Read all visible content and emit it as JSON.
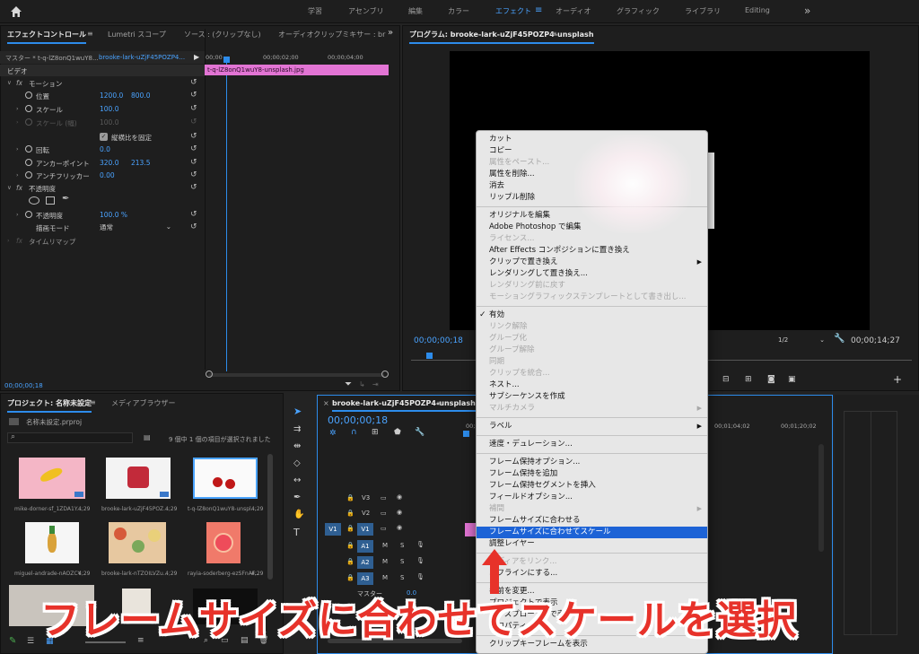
{
  "workspaces": [
    "学習",
    "アセンブリ",
    "編集",
    "カラー",
    "エフェクト",
    "オーディオ",
    "グラフィック",
    "ライブラリ",
    "Editing"
  ],
  "active_workspace": "エフェクト",
  "effect_controls": {
    "tabs": [
      "エフェクトコントロール",
      "Lumetri スコープ",
      "ソース : (クリップなし)",
      "オーディオクリップミキサー : br"
    ],
    "master_label": "マスター * t-q-lZ8onQ1wuY8...",
    "clip_label": "brooke-lark-uZjF45POZP4...",
    "section_video": "ビデオ",
    "motion": "モーション",
    "position": {
      "label": "位置",
      "x": "1200.0",
      "y": "800.0"
    },
    "scale": {
      "label": "スケール",
      "value": "100.0"
    },
    "scale_width": {
      "label": "スケール (幅)",
      "value": "100.0"
    },
    "uniform_scale": "縦横比を固定",
    "rotation": {
      "label": "回転",
      "value": "0.0"
    },
    "anchor": {
      "label": "アンカーポイント",
      "x": "320.0",
      "y": "213.5"
    },
    "antiflicker": {
      "label": "アンチフリッカー",
      "value": "0.00"
    },
    "opacity_section": "不透明度",
    "opacity": {
      "label": "不透明度",
      "value": "100.0 %"
    },
    "blend": {
      "label": "描画モード",
      "value": "通常"
    },
    "time_remap": "タイムリマップ",
    "ruler": [
      "00;00",
      "00;00;02;00",
      "00;00;04;00"
    ],
    "clip_name": "t-q-lZ8onQ1wuY8-unsplash.jpg",
    "timecode": "00;00;00;18"
  },
  "program": {
    "title": "プログラム: brooke-lark-uZjF45POZP4-unsplash",
    "timecode": "00;00;00;18",
    "resolution": "1/2",
    "duration": "00;00;14;27"
  },
  "project": {
    "tabs": [
      "プロジェクト: 名称未設定",
      "メディアブラウザー"
    ],
    "file": "名称未設定.prproj",
    "selection_info": "9 個中 1 個の項目が選択されました",
    "items": [
      {
        "name": "mike-dorner-sf_1ZDA1Y...",
        "dur": "4;29"
      },
      {
        "name": "brooke-lark-uZjF45POZ...",
        "dur": "4;29"
      },
      {
        "name": "t-q-lZ8onQ1wuY8-unspl...",
        "dur": "4;29"
      },
      {
        "name": "miguel-andrade-nAOZCY...",
        "dur": "4;29"
      },
      {
        "name": "brooke-lark-nTZOILVZu...",
        "dur": "4;29"
      },
      {
        "name": "rayia-soderberg-ezSFnAF...",
        "dur": "4;29"
      }
    ]
  },
  "timeline": {
    "sequence": "brooke-lark-uZjF45POZP4-unsplash",
    "timecode": "00;00;00;18",
    "ruler": [
      "00;00",
      "00;01;04;02",
      "00;01;20;02"
    ],
    "tracks": [
      "V3",
      "V2",
      "V1",
      "A1",
      "A2",
      "A3"
    ],
    "master": "マスター",
    "master_value": "0.0"
  },
  "context_menu": [
    {
      "label": "カット",
      "enabled": true
    },
    {
      "label": "コピー",
      "enabled": true
    },
    {
      "label": "属性をペースト...",
      "enabled": false
    },
    {
      "label": "属性を削除...",
      "enabled": true
    },
    {
      "label": "消去",
      "enabled": true
    },
    {
      "label": "リップル削除",
      "enabled": true
    },
    {
      "sep": true
    },
    {
      "label": "オリジナルを編集",
      "enabled": true
    },
    {
      "label": "Adobe Photoshop で編集",
      "enabled": true
    },
    {
      "label": "ライセンス...",
      "enabled": false
    },
    {
      "label": "After Effects コンポジションに置き換え",
      "enabled": true
    },
    {
      "label": "クリップで置き換え",
      "enabled": true,
      "submenu": true
    },
    {
      "label": "レンダリングして置き換え...",
      "enabled": true
    },
    {
      "label": "レンダリング前に戻す",
      "enabled": false
    },
    {
      "label": "モーショングラフィックステンプレートとして書き出し...",
      "enabled": false
    },
    {
      "sep": true
    },
    {
      "label": "有効",
      "enabled": true,
      "checked": true
    },
    {
      "label": "リンク解除",
      "enabled": false
    },
    {
      "label": "グループ化",
      "enabled": false
    },
    {
      "label": "グループ解除",
      "enabled": false
    },
    {
      "label": "同期",
      "enabled": false
    },
    {
      "label": "クリップを統合...",
      "enabled": false
    },
    {
      "label": "ネスト...",
      "enabled": true
    },
    {
      "label": "サブシーケンスを作成",
      "enabled": true
    },
    {
      "label": "マルチカメラ",
      "enabled": false,
      "submenu": true
    },
    {
      "sep": true
    },
    {
      "label": "ラベル",
      "enabled": true,
      "submenu": true
    },
    {
      "sep": true
    },
    {
      "label": "速度・デュレーション...",
      "enabled": true
    },
    {
      "sep": true
    },
    {
      "label": "フレーム保持オプション...",
      "enabled": true
    },
    {
      "label": "フレーム保持を追加",
      "enabled": true
    },
    {
      "label": "フレーム保持セグメントを挿入",
      "enabled": true
    },
    {
      "label": "フィールドオプション...",
      "enabled": true
    },
    {
      "label": "補間",
      "enabled": false,
      "submenu": true
    },
    {
      "label": "フレームサイズに合わせる",
      "enabled": true
    },
    {
      "label": "フレームサイズに合わせてスケール",
      "enabled": true,
      "highlighted": true
    },
    {
      "label": "調整レイヤー",
      "enabled": true
    },
    {
      "sep": true
    },
    {
      "label": "メディアをリンク...",
      "enabled": false
    },
    {
      "label": "オフラインにする...",
      "enabled": true
    },
    {
      "sep": true
    },
    {
      "label": "名前を変更...",
      "enabled": true
    },
    {
      "label": "プロジェクトで表示",
      "enabled": true
    },
    {
      "label": "エクスプローラーで表示...",
      "enabled": true
    },
    {
      "label": "プロパティ",
      "enabled": true
    },
    {
      "sep": true
    },
    {
      "label": "クリップキーフレームを表示",
      "enabled": true
    }
  ],
  "annotation": {
    "caption": "フレームサイズに合わせてスケールを選択",
    "color": "#e7322a"
  },
  "colors": {
    "accent": "#2d8ceb",
    "clip_pink": "#e274d4",
    "menu_highlight": "#1d63d6"
  }
}
